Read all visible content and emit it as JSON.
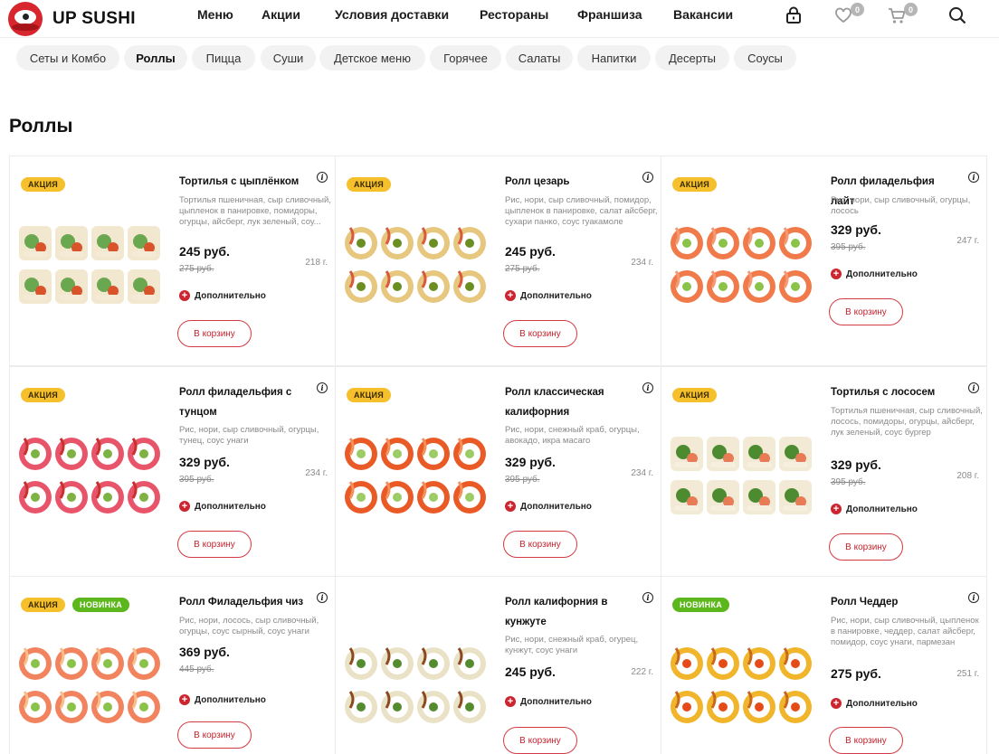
{
  "brand": {
    "name": "UP SUSHI",
    "color": "#d8262e"
  },
  "nav": [
    "Меню",
    "Акции",
    "Условия доставки",
    "Рестораны",
    "Франшиза",
    "Вакансии"
  ],
  "header_icons": {
    "account": "lock-icon",
    "favorites": "heart-icon",
    "favorites_count": "0",
    "cart": "cart-icon",
    "cart_count": "0",
    "search": "search-icon"
  },
  "categories": [
    "Сеты и Комбо",
    "Роллы",
    "Пицца",
    "Суши",
    "Детское меню",
    "Горячее",
    "Салаты",
    "Напитки",
    "Десерты",
    "Соусы"
  ],
  "active_category": "Роллы",
  "page_title": "Роллы",
  "labels": {
    "extra": "Дополнительно",
    "cart_button": "В корзину",
    "tag_sale": "АКЦИЯ",
    "tag_new": "НОВИНКА"
  },
  "products": [
    {
      "title": "Тортилья с цыплёнком",
      "desc": "Тортилья пшеничная, сыр сливочный, цыпленок в панировке, помидоры, огурцы, айсберг, лук зеленый, соу...",
      "price": "245 руб.",
      "old_price": "275 руб.",
      "weight": "218 г.",
      "tags": [
        "АКЦИЯ"
      ]
    },
    {
      "title": "Ролл цезарь",
      "desc": "Рис, нори, сыр сливочный, помидор, цыпленок в панировке, салат айсберг, сухари панко, соус гуакамоле",
      "price": "245 руб.",
      "old_price": "275 руб.",
      "weight": "234 г.",
      "tags": [
        "АКЦИЯ"
      ]
    },
    {
      "title": "Ролл филадельфия лайт",
      "desc": "Рис, нори, сыр сливочный, огурцы, лосось",
      "price": "329 руб.",
      "old_price": "395 руб.",
      "weight": "247 г.",
      "tags": [
        "АКЦИЯ"
      ]
    },
    {
      "title": "Ролл филадельфия с тунцом",
      "desc": "Рис, нори, сыр сливочный, огурцы, тунец, соус унаги",
      "price": "329 руб.",
      "old_price": "395 руб.",
      "weight": "234 г.",
      "tags": [
        "АКЦИЯ"
      ]
    },
    {
      "title": "Ролл классическая калифорния",
      "desc": "Рис, нори, снежный краб, огурцы, авокадо, икра масаго",
      "price": "329 руб.",
      "old_price": "395 руб.",
      "weight": "234 г.",
      "tags": [
        "АКЦИЯ"
      ]
    },
    {
      "title": "Тортилья с лососем",
      "desc": "Тортилья пшеничная, сыр сливочный, лосось, помидоры, огурцы, айсберг, лук зеленый, соус бургер",
      "price": "329 руб.",
      "old_price": "395 руб.",
      "weight": "208 г.",
      "tags": [
        "АКЦИЯ"
      ]
    },
    {
      "title": "Ролл Филадельфия чиз",
      "desc": "Рис, нори, лосось, сыр сливочный, огурцы, соус сырный, соус унаги",
      "price": "369 руб.",
      "old_price": "445 руб.",
      "weight": "",
      "tags": [
        "АКЦИЯ",
        "НОВИНКА"
      ]
    },
    {
      "title": "Ролл калифорния в кунжуте",
      "desc": "Рис, нори, снежный краб, огурец, кунжут, соус унаги",
      "price": "245 руб.",
      "old_price": "",
      "weight": "222 г.",
      "tags": []
    },
    {
      "title": "Ролл Чеддер",
      "desc": "Рис, нори, сыр сливочный, цыпленок в панировке, чеддер, салат айсберг, помидор, соус унаги, пармезан",
      "price": "275 руб.",
      "old_price": "",
      "weight": "251 г.",
      "tags": [
        "НОВИНКА"
      ]
    }
  ]
}
